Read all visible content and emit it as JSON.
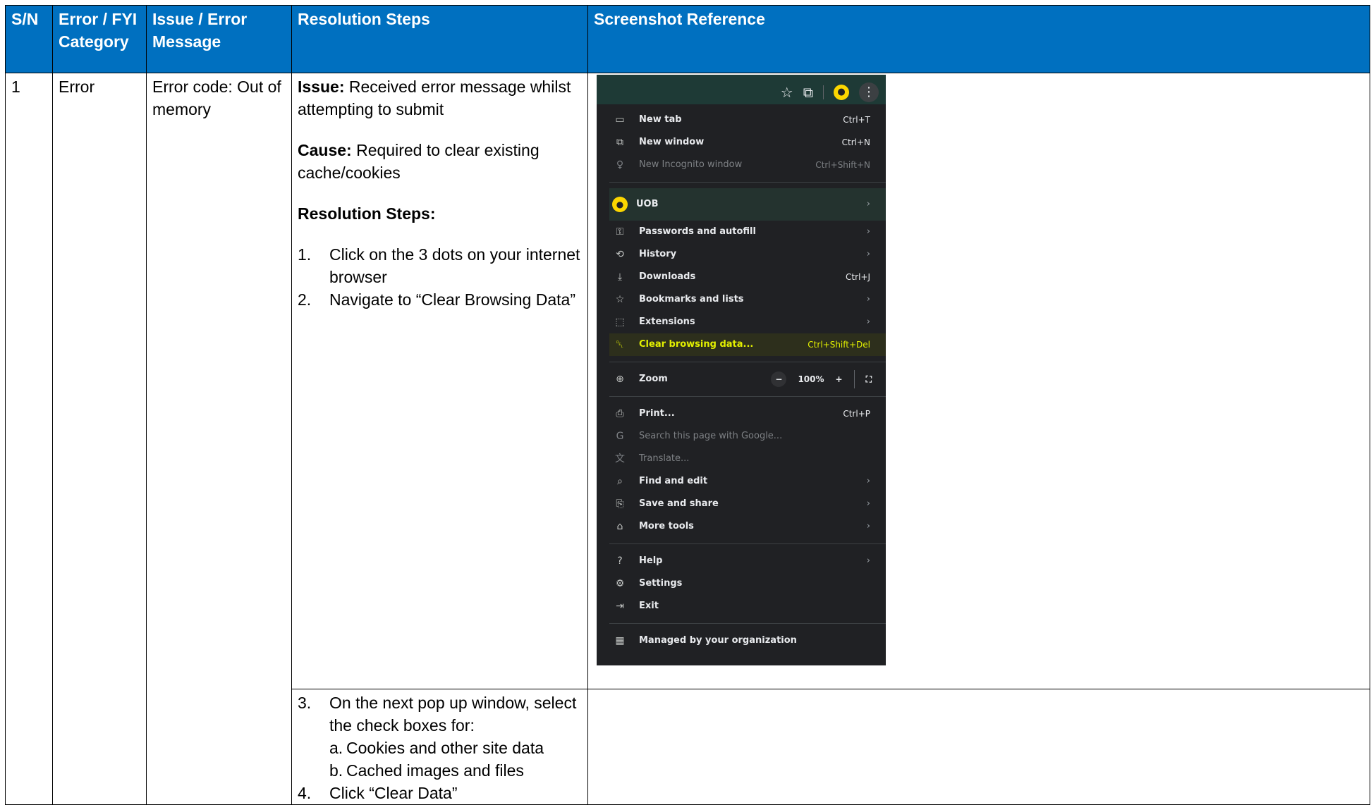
{
  "table": {
    "headers": [
      "S/N",
      "Error / FYI Category",
      "Issue / Error Message",
      "Resolution Steps",
      "Screenshot Reference"
    ],
    "row1": {
      "sn": "1",
      "category": "Error",
      "message": "Error code: Out of memory",
      "issue_label": "Issue:",
      "issue_text": " Received error message whilst attempting to submit",
      "cause_label": "Cause:",
      "cause_text": " Required to clear existing cache/cookies",
      "steps_heading": "Resolution Steps:",
      "steps": [
        {
          "num": "1.",
          "text": "Click on the 3 dots on your internet browser"
        },
        {
          "num": "2.",
          "text": "Navigate to “Clear Browsing Data”"
        }
      ]
    },
    "row2": {
      "steps": [
        {
          "num": "3.",
          "text": "On the next pop up window, select the check boxes for:"
        }
      ],
      "substeps": [
        {
          "letter": "a.",
          "text": "Cookies and other site data"
        },
        {
          "letter": "b.",
          "text": "Cached images and files"
        }
      ],
      "last_step": {
        "num": "4.",
        "text": "Click “Clear Data”"
      }
    }
  },
  "screenshot": {
    "menu_items": [
      {
        "icon": "new-tab-icon",
        "glyph": "▭",
        "label": "New tab",
        "shortcut": "Ctrl+T"
      },
      {
        "icon": "new-window-icon",
        "glyph": "⧉",
        "label": "New window",
        "shortcut": "Ctrl+N"
      },
      {
        "icon": "incognito-icon",
        "glyph": "♀",
        "label": "New Incognito window",
        "shortcut": "Ctrl+Shift+N"
      }
    ],
    "profile": "UOB",
    "items2": [
      {
        "icon": "key-icon",
        "glyph": "⚿",
        "label": "Passwords and autofill",
        "shortcut": "",
        "arrow": "›"
      },
      {
        "icon": "history-icon",
        "glyph": "⟲",
        "label": "History",
        "shortcut": "",
        "arrow": "›"
      },
      {
        "icon": "download-icon",
        "glyph": "⤓",
        "label": "Downloads",
        "shortcut": "Ctrl+J",
        "arrow": ""
      },
      {
        "icon": "star-icon",
        "glyph": "☆",
        "label": "Bookmarks and lists",
        "shortcut": "",
        "arrow": "›"
      },
      {
        "icon": "puzzle-icon",
        "glyph": "⬚",
        "label": "Extensions",
        "shortcut": "",
        "arrow": "›"
      },
      {
        "icon": "trash-icon",
        "glyph": "␡",
        "label": "Clear browsing data...",
        "shortcut": "Ctrl+Shift+Del",
        "arrow": ""
      }
    ],
    "zoom": {
      "label": "Zoom",
      "minus": "−",
      "value": "100%",
      "plus": "+"
    },
    "items3": [
      {
        "icon": "print-icon",
        "glyph": "⎙",
        "label": "Print...",
        "shortcut": "Ctrl+P",
        "arrow": ""
      },
      {
        "icon": "google-icon",
        "glyph": "G",
        "label": "Search this page with Google...",
        "shortcut": "",
        "arrow": ""
      },
      {
        "icon": "translate-icon",
        "glyph": "文",
        "label": "Translate...",
        "shortcut": "",
        "arrow": ""
      },
      {
        "icon": "find-icon",
        "glyph": "⌕",
        "label": "Find and edit",
        "shortcut": "",
        "arrow": "›"
      },
      {
        "icon": "save-share-icon",
        "glyph": "⎘",
        "label": "Save and share",
        "shortcut": "",
        "arrow": "›"
      },
      {
        "icon": "toolbox-icon",
        "glyph": "⌂",
        "label": "More tools",
        "shortcut": "",
        "arrow": "›"
      }
    ],
    "items4": [
      {
        "icon": "help-icon",
        "glyph": "?",
        "label": "Help",
        "shortcut": "",
        "arrow": "›"
      },
      {
        "icon": "settings-icon",
        "glyph": "⚙",
        "label": "Settings",
        "shortcut": "",
        "arrow": ""
      },
      {
        "icon": "exit-icon",
        "glyph": "⇥",
        "label": "Exit",
        "shortcut": "",
        "arrow": ""
      }
    ],
    "managed": "Managed by your organization"
  }
}
